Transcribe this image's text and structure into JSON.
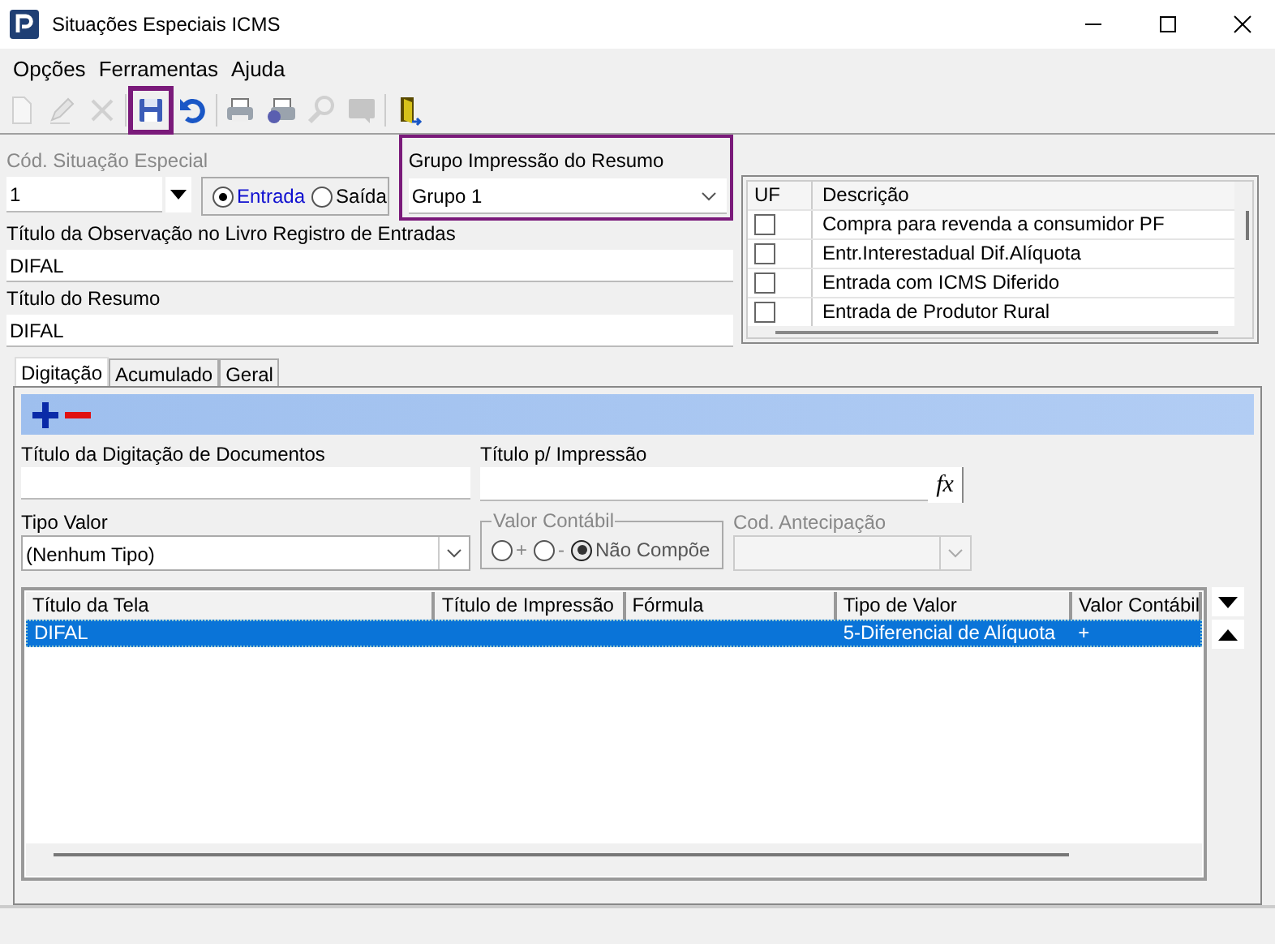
{
  "window": {
    "title": "Situações Especiais ICMS"
  },
  "menu": [
    "Opções",
    "Ferramentas",
    "Ajuda"
  ],
  "toolbar": [
    {
      "kind": "new",
      "disabled": true,
      "highlighted": false
    },
    {
      "kind": "edit",
      "disabled": true,
      "highlighted": false
    },
    {
      "kind": "delete",
      "disabled": true,
      "highlighted": false
    },
    {
      "kind": "save",
      "disabled": false,
      "highlighted": true
    },
    {
      "kind": "undo",
      "disabled": false,
      "highlighted": false
    },
    {
      "kind": "print",
      "disabled": false,
      "highlighted": false
    },
    {
      "kind": "print-setup",
      "disabled": false,
      "highlighted": false
    },
    {
      "kind": "search",
      "disabled": true,
      "highlighted": false
    },
    {
      "kind": "comment",
      "disabled": true,
      "highlighted": false
    },
    {
      "kind": "exit",
      "disabled": false,
      "highlighted": false
    }
  ],
  "codigo": {
    "label": "Cód. Situação Especial",
    "value": "1",
    "disabled": true
  },
  "tipo": [
    {
      "label": "Entrada",
      "selected": true
    },
    {
      "label": "Saída",
      "selected": false
    }
  ],
  "grupo": {
    "label": "Grupo Impressão do Resumo",
    "value": "Grupo 1",
    "highlighted": true
  },
  "titulo_observacao": {
    "label": "Título da Observação no Livro Registro de Entradas",
    "value": "DIFAL"
  },
  "titulo_resumo": {
    "label": "Título do Resumo",
    "value": "DIFAL"
  },
  "uf_table": {
    "columns": [
      "UF",
      "Descrição"
    ],
    "rows": [
      {
        "checked": false,
        "descricao": "Compra para revenda a consumidor PF"
      },
      {
        "checked": false,
        "descricao": "Entr.Interestadual Dif.Alíquota"
      },
      {
        "checked": false,
        "descricao": "Entrada com ICMS Diferido"
      },
      {
        "checked": false,
        "descricao": "Entrada de Produtor Rural"
      }
    ]
  },
  "tabs": [
    {
      "label": "Digitação",
      "selected": true
    },
    {
      "label": "Acumulado",
      "selected": false
    },
    {
      "label": "Geral",
      "selected": false
    }
  ],
  "titulo_digitacao": {
    "label": "Título da Digitação de Documentos"
  },
  "titulo_impressao": {
    "label": "Título p/ Impressão",
    "button": "fx"
  },
  "tipo_valor": {
    "label": "Tipo Valor",
    "value": "(Nenhum Tipo)"
  },
  "valor_contabil": {
    "label": "Valor Contábil",
    "disabled": true,
    "options": [
      {
        "label": "+",
        "selected": false
      },
      {
        "label": "-",
        "selected": false
      },
      {
        "label": "Não Compõe",
        "selected": true
      }
    ]
  },
  "cod_antecipacao": {
    "label": "Cod. Antecipação",
    "disabled": true
  },
  "grid": {
    "columns": [
      "Título da Tela",
      "Título de Impressão",
      "Fórmula",
      "Tipo de Valor",
      "Valor Contábil"
    ],
    "rows": [
      {
        "selected": true,
        "cells": [
          "DIFAL",
          "",
          "",
          "5-Diferencial de Alíquota",
          "+"
        ]
      }
    ]
  }
}
